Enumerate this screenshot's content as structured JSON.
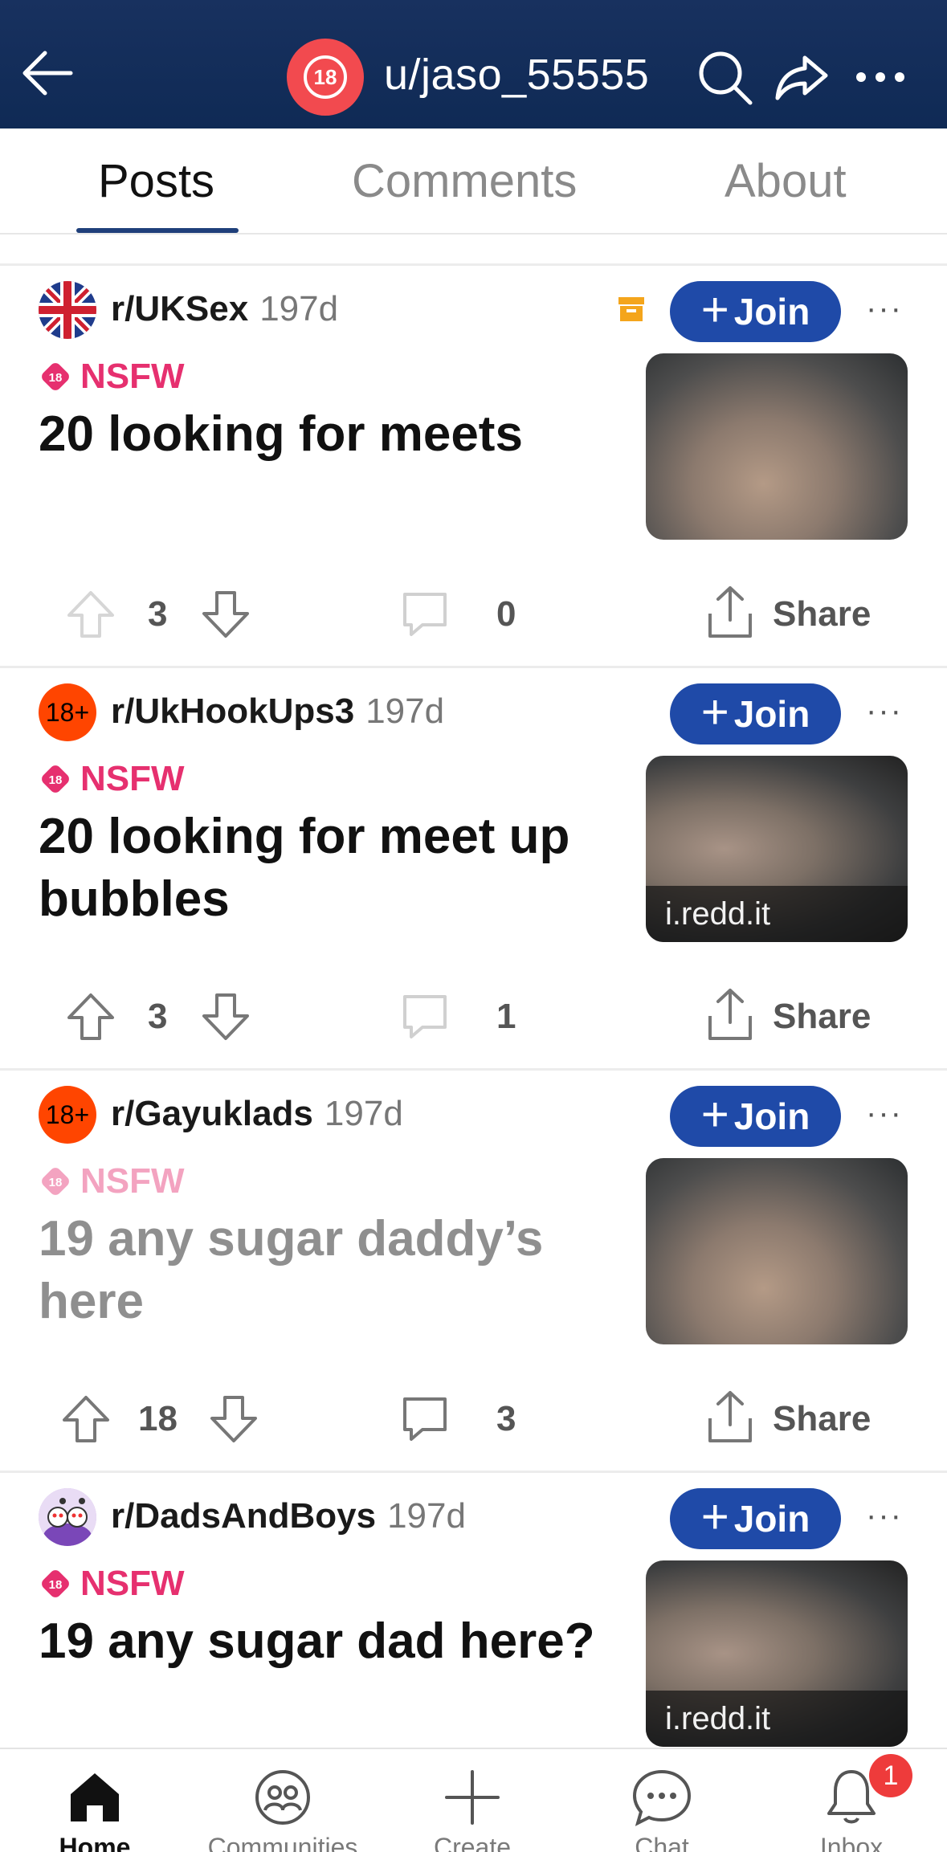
{
  "header": {
    "username": "u/jaso_55555",
    "avatar_badge": "18",
    "icons": [
      "back-arrow-icon",
      "search-icon",
      "share-icon",
      "more-icon"
    ]
  },
  "tabs": [
    {
      "label": "Posts",
      "active": true
    },
    {
      "label": "Comments",
      "active": false
    },
    {
      "label": "About",
      "active": false
    }
  ],
  "posts": [
    {
      "subreddit": "r/UKSex",
      "age": "197d",
      "archived": true,
      "join_label": "Join",
      "nsfw_label": "NSFW",
      "title": "20 looking for meets",
      "thumbnail_source": "",
      "upvotes": "3",
      "comments": "0",
      "share_label": "Share",
      "faded": false
    },
    {
      "subreddit": "r/UkHookUps3",
      "age": "197d",
      "archived": false,
      "join_label": "Join",
      "nsfw_label": "NSFW",
      "title": "20 looking for meet up bubbles",
      "thumbnail_source": "i.redd.it",
      "upvotes": "3",
      "comments": "1",
      "share_label": "Share",
      "faded": false
    },
    {
      "subreddit": "r/Gayuklads",
      "age": "197d",
      "archived": false,
      "join_label": "Join",
      "nsfw_label": "NSFW",
      "title": "19 any sugar daddy’s here",
      "thumbnail_source": "",
      "upvotes": "18",
      "comments": "3",
      "share_label": "Share",
      "faded": true
    },
    {
      "subreddit": "r/DadsAndBoys",
      "age": "197d",
      "archived": false,
      "join_label": "Join",
      "nsfw_label": "NSFW",
      "title": "19 any sugar dad here?",
      "thumbnail_source": "i.redd.it",
      "faded": false
    }
  ],
  "bottom_nav": [
    {
      "label": "Home",
      "icon": "home-icon",
      "active": true
    },
    {
      "label": "Communities",
      "icon": "communities-icon",
      "active": false
    },
    {
      "label": "Create",
      "icon": "create-icon",
      "active": false
    },
    {
      "label": "Chat",
      "icon": "chat-icon",
      "active": false
    },
    {
      "label": "Inbox",
      "icon": "inbox-icon",
      "active": false
    }
  ],
  "inbox_badge": "1",
  "colors": {
    "header_bg": "#0f2a55",
    "join_button": "#1f4aa8",
    "nsfw": "#e6306f",
    "badge": "#ee3b3b"
  }
}
